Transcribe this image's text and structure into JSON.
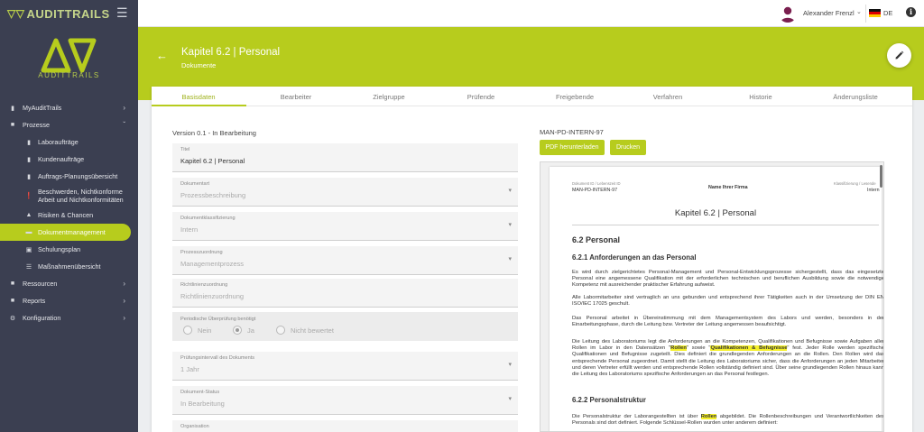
{
  "brand": {
    "name": "AUDITTRAILS",
    "logo_text": "AUDITTRAILS"
  },
  "sidebar": {
    "items": [
      {
        "label": "MyAuditTrails",
        "icon": "bookmark-icon"
      },
      {
        "label": "Prozesse",
        "icon": "folder-icon"
      },
      {
        "label": "Laboraufträge",
        "icon": "file-icon"
      },
      {
        "label": "Kundenaufträge",
        "icon": "file-icon"
      },
      {
        "label": "Auftrags-Planungsübersicht",
        "icon": "file-icon"
      },
      {
        "label": "Beschwerden, Nichtkonforme Arbeit und Nichtkonformitäten",
        "icon": "info-icon"
      },
      {
        "label": "Risiken & Chancen",
        "icon": "warning-icon"
      },
      {
        "label": "Dokumentmanagement",
        "icon": "document-icon"
      },
      {
        "label": "Schulungsplan",
        "icon": "calendar-icon"
      },
      {
        "label": "Maßnahmenübersicht",
        "icon": "list-icon"
      },
      {
        "label": "Ressourcen",
        "icon": "folder-icon"
      },
      {
        "label": "Reports",
        "icon": "folder-icon"
      },
      {
        "label": "Konfiguration",
        "icon": "gear-icon"
      }
    ]
  },
  "topbar": {
    "user_name": "Alexander Frenzl",
    "language": "DE"
  },
  "header": {
    "title": "Kapitel 6.2 | Personal",
    "subtitle": "Dokumente"
  },
  "tabs": [
    "Basisdaten",
    "Bearbeiter",
    "Zielgruppe",
    "Prüfende",
    "Freigebende",
    "Verfahren",
    "Historie",
    "Änderungsliste"
  ],
  "form": {
    "version": "Version 0.1 - In Bearbeitung",
    "fields": [
      {
        "label": "Titel",
        "value": "Kapitel 6.2 | Personal"
      },
      {
        "label": "Dokumentart",
        "value": "Prozessbeschreibung"
      },
      {
        "label": "Dokumentklassifizierung",
        "value": "Intern"
      },
      {
        "label": "Prozesszuordnung",
        "value": "Managementprozess"
      },
      {
        "label": "Richtlinienzuordnung",
        "value": "Richtlinienzuordnung"
      }
    ],
    "periodic_label": "Periodische Überprüfung benötigt",
    "radio_options": [
      "Nein",
      "Ja",
      "Nicht bewertet"
    ],
    "fields2": [
      {
        "label": "Prüfungsintervall des Dokuments",
        "value": "1 Jahr"
      },
      {
        "label": "Dokument-Status",
        "value": "In Bearbeitung"
      },
      {
        "label": "Organisation",
        "value": ""
      }
    ]
  },
  "doc": {
    "code": "MAN-PD-INTERN-97",
    "btn_pdf": "PDF herunterladen",
    "btn_print": "Drucken"
  },
  "pdf": {
    "hdr_left_label": "Dokument ID / Lebenszeit ID",
    "hdr_left_value": "MAN-PD-INTERN-97",
    "hdr_center": "Name Ihrer Firma",
    "hdr_right_label": "Klassifizierung / Lesende",
    "hdr_right_value": "Intern",
    "title": "Kapitel 6.2 | Personal",
    "h1": "6.2 Personal",
    "h2a": "6.2.1 Anforderungen an das Personal",
    "p1": "Es wird durch zielgerichtetes Personal-Management und Personal-Entwicklungsprozesse sichergestellt, dass das eingesetzte Personal eine angemessene Qualifikation mit der erforderlichen technischen und beruflichen Ausbildung sowie die notwendige Kompetenz mit ausreichender praktischer Erfahrung aufweist.",
    "p2": "Alle Labormitarbeiter sind vertraglich an uns gebunden und entsprechend ihrer Tätigkeiten auch in der Umsetzung der DIN EN ISO/IEC 17025 geschult.",
    "p3": "Das Personal arbeitet in Übereinstimmung mit dem Managementsystem des Labors und werden, besonders in der Einarbeitungsphase, durch die Leitung bzw. Vertreter der Leitung angemessen beaufsichtigt.",
    "p4a": "Die Leitung des Laboratoriums legt die Anforderungen an die Kompetenzen, Qualifikationen und Befugnisse sowie Aufgaben aller Rollen im Labor in den Datensätzen \"",
    "p4_hl1": "Rollen",
    "p4b": "\" sowie \"",
    "p4_hl2": "Qualifikationen & Befugnisse",
    "p4c": "\" fest. Jeder Rolle werden spezifische Qualifikationen und Befugnisse zugeteilt. Dies definiert die grundlegenden Anforderungen an die Rollen. Den Rollen wird das entsprechende Personal zugeordnet. Damit stellt die Leitung des Laboratoriums sicher, dass die Anforderungen an jeden Mitarbeiter und deren Vertreter erfüllt werden und entsprechende Rollen vollständig definiert sind. Über seine grundlegenden Rollen hinaus kann die Leitung des Laboratoriums spezifische Anforderungen an das Personal festlegen.",
    "h2b": "6.2.2 Personalstruktur",
    "p5a": "Die Personalstruktur der Laborangestellten ist über ",
    "p5_hl": "Rollen",
    "p5b": " abgebildet. Die Rollenbeschreibungen und Verantwortlichkeiten des Personals sind dort definiert. Folgende Schlüssel-Rollen wurden unter anderem definiert:"
  }
}
